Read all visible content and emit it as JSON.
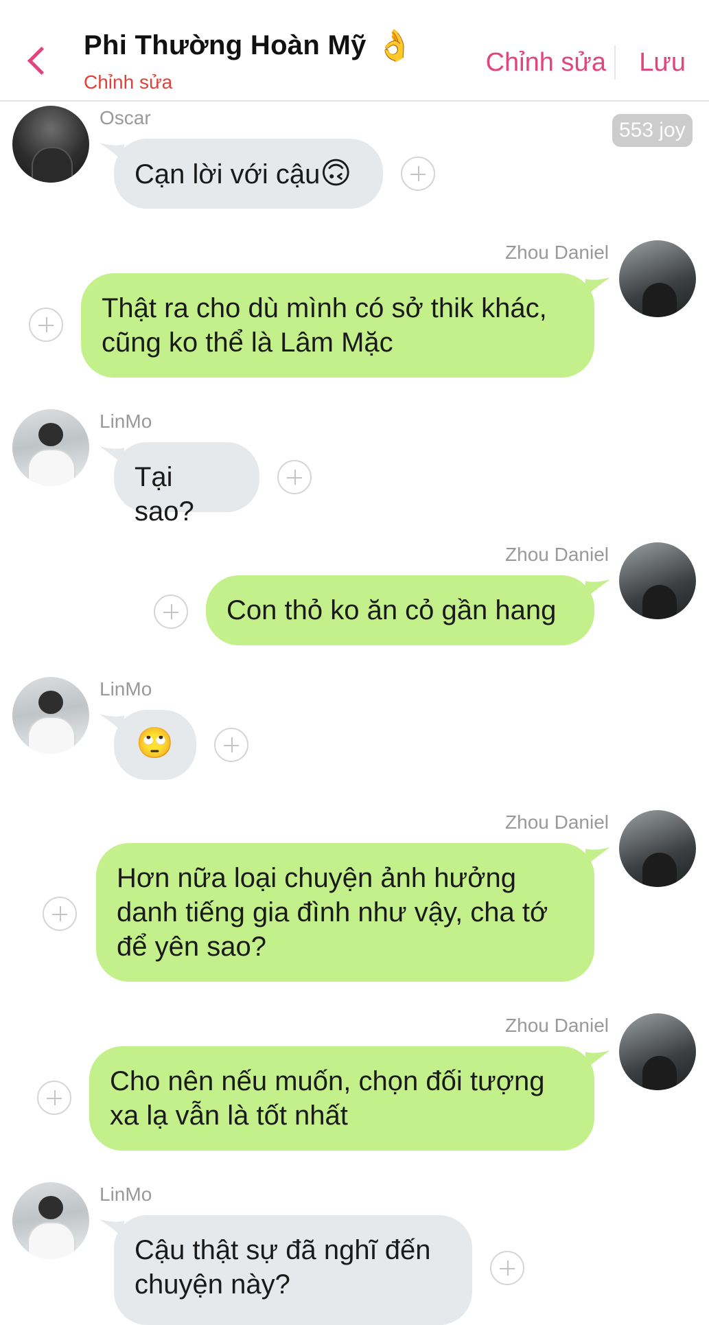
{
  "header": {
    "title": "Phi Thường Hoàn Mỹ",
    "title_emoji": "👌",
    "subtitle": "Chỉnh sửa",
    "edit_label": "Chỉnh sửa",
    "save_label": "Lưu",
    "accent_color": "#e0457b",
    "subtitle_color": "#e0423a"
  },
  "badge": {
    "joy": "553 joy"
  },
  "colors": {
    "incoming_bubble": "#e6e9eb",
    "outgoing_bubble": "#c3f08a"
  },
  "messages": [
    {
      "sender": "Oscar",
      "direction": "incoming",
      "text": "Cạn lời với cậu",
      "emoji": "🙃"
    },
    {
      "sender": "Zhou Daniel",
      "direction": "outgoing",
      "line1": "Thật ra cho dù mình có sở thik khác,",
      "line2": "cũng ko thể là Lâm Mặc"
    },
    {
      "sender": "LinMo",
      "direction": "incoming",
      "text": "Tại sao?"
    },
    {
      "sender": "Zhou Daniel",
      "direction": "outgoing",
      "text": "Con thỏ ko ăn cỏ gần hang"
    },
    {
      "sender": "LinMo",
      "direction": "incoming",
      "emoji": "🙄"
    },
    {
      "sender": "Zhou Daniel",
      "direction": "outgoing",
      "line1": "Hơn nữa loại chuyện ảnh hưởng",
      "line2": "danh tiếng gia đình như vậy, cha tớ",
      "line3": "để yên sao?"
    },
    {
      "sender": "Zhou Daniel",
      "direction": "outgoing",
      "line1": "Cho nên nếu muốn, chọn đối tượng",
      "line2": "xa lạ vẫn là tốt nhất"
    },
    {
      "sender": "LinMo",
      "direction": "incoming",
      "line1": "Cậu thật sự đã nghĩ đến",
      "line2": "chuyện này?"
    }
  ]
}
